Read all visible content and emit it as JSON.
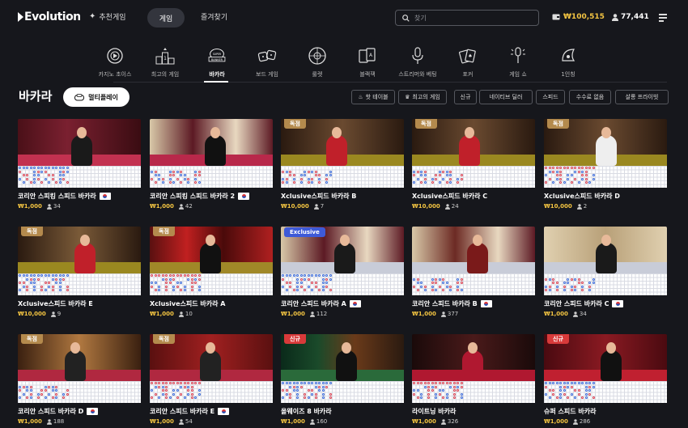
{
  "brand": {
    "name": "Evolution"
  },
  "nav": {
    "recommended": "추천게임",
    "games": "게임",
    "favorites": "즐겨찾기"
  },
  "search": {
    "placeholder": "찾기"
  },
  "account": {
    "balance": "₩100,515",
    "players": "77,441"
  },
  "categories": [
    {
      "label": "카지노 초이스",
      "icon": "casino-choice-icon"
    },
    {
      "label": "최고의 게임",
      "icon": "podium-icon"
    },
    {
      "label": "바카라",
      "icon": "baccarat-icon",
      "active": true
    },
    {
      "label": "보드 게임",
      "icon": "dice-icon"
    },
    {
      "label": "룰렛",
      "icon": "roulette-icon"
    },
    {
      "label": "블랙잭",
      "icon": "cards-icon"
    },
    {
      "label": "스트리머와 베팅",
      "icon": "microphone-icon"
    },
    {
      "label": "포커",
      "icon": "poker-icon"
    },
    {
      "label": "게임 쇼",
      "icon": "game-show-icon"
    },
    {
      "label": "1인칭",
      "icon": "first-person-icon"
    }
  ],
  "page": {
    "title": "바카라",
    "multiplay": "멀티플레이"
  },
  "filters": [
    "핫 테이블",
    "최고의 게임",
    "신규",
    "네이티브 딜러",
    "스피드",
    "수수료 없음",
    "살롱 프라이빗"
  ],
  "games": [
    {
      "name": "코리안 스피킹 스피드 바카라",
      "bet": "₩1,000",
      "players": "34",
      "flag": true,
      "badge": ""
    },
    {
      "name": "코리안 스피킹 스피드 바카라 2",
      "bet": "₩1,000",
      "players": "42",
      "flag": true,
      "badge": ""
    },
    {
      "name": "Xclusive스피드 바카라 B",
      "bet": "₩10,000",
      "players": "7",
      "flag": false,
      "badge": "독점"
    },
    {
      "name": "Xclusive스피드 바카라 C",
      "bet": "₩10,000",
      "players": "24",
      "flag": false,
      "badge": "독점"
    },
    {
      "name": "Xclusive스피드 바카라 D",
      "bet": "₩10,000",
      "players": "2",
      "flag": false,
      "badge": "독점"
    },
    {
      "name": "Xclusive스피드 바카라 E",
      "bet": "₩10,000",
      "players": "9",
      "flag": false,
      "badge": "독점"
    },
    {
      "name": "Xclusive스피드 바카라 A",
      "bet": "₩1,000",
      "players": "10",
      "flag": false,
      "badge": "독점"
    },
    {
      "name": "코리안 스피드 바카라 A",
      "bet": "₩1,000",
      "players": "112",
      "flag": true,
      "badge": "Exclusive"
    },
    {
      "name": "코리안 스피드 바카라 B",
      "bet": "₩1,000",
      "players": "377",
      "flag": true,
      "badge": ""
    },
    {
      "name": "코리안 스피드 바카라 C",
      "bet": "₩1,000",
      "players": "34",
      "flag": true,
      "badge": ""
    },
    {
      "name": "코리안 스피드 바카라 D",
      "bet": "₩1,000",
      "players": "188",
      "flag": true,
      "badge": "독점"
    },
    {
      "name": "코리안 스피드 바카라 E",
      "bet": "₩1,000",
      "players": "54",
      "flag": true,
      "badge": "독점"
    },
    {
      "name": "올웨이즈 8 바카라",
      "bet": "₩1,000",
      "players": "160",
      "flag": false,
      "badge": "신규"
    },
    {
      "name": "라이트닝 바카라",
      "bet": "₩1,000",
      "players": "326",
      "flag": false,
      "badge": ""
    },
    {
      "name": "슈퍼 스피드 바카라",
      "bet": "₩1,000",
      "players": "286",
      "flag": false,
      "badge": "신규"
    }
  ],
  "colors": {
    "background": "#16171c",
    "balance": "#f4c542",
    "exclusive_badge": "#b48a4d",
    "new_badge": "#d83a3a",
    "exclusive_blue": "#3e5ad8"
  }
}
